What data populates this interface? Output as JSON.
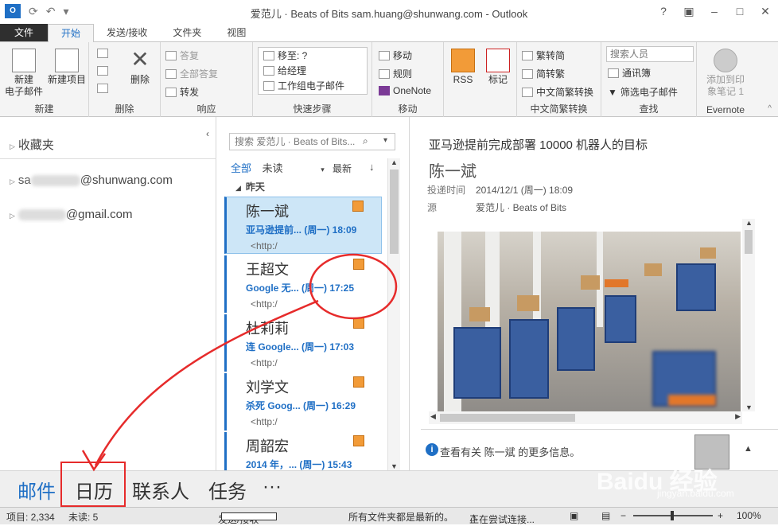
{
  "window": {
    "title": "爱范儿 · Beats of Bits   sam.huang@shunwang.com - Outlook",
    "app_icon": "O"
  },
  "tabs": [
    "文件",
    "开始",
    "发送/接收",
    "文件夹",
    "视图"
  ],
  "ribbon": {
    "new_email": "新建\n电子邮件",
    "new_items": "新建项目",
    "group_new": "新建",
    "delete": "删除",
    "group_delete": "删除",
    "reply": "答复",
    "reply_all": "全部答复",
    "forward": "转发",
    "group_respond": "响应",
    "quick_steps": [
      "移至: ?",
      "给经理",
      "工作组电子邮件"
    ],
    "group_quick": "快速步骤",
    "move": "移动",
    "rules": "规则",
    "onenote": "OneNote",
    "group_move": "移动",
    "rss": "RSS",
    "tag": "标记",
    "trad_to_simp": "繁转简",
    "simp_to_trad": "简转繁",
    "convert": "中文简繁转换",
    "group_cn": "中文简繁转换",
    "search_people": "搜索人员",
    "address_book": "通讯簿",
    "filter_email": "筛选电子邮件",
    "group_find": "查找",
    "evernote_add": "添加到印\n象笔记 1",
    "group_evernote": "Evernote"
  },
  "nav": {
    "favorites": "收藏夹",
    "account1_suffix": "@shunwang.com",
    "account2_suffix": "@gmail.com"
  },
  "list": {
    "search_placeholder": "搜索 爱范儿 · Beats of Bits...",
    "filter_all": "全部",
    "filter_unread": "未读",
    "sort": "最新",
    "group": "昨天",
    "items": [
      {
        "sender": "陈一斌",
        "subject": "亚马逊提前... (周一) 18:09",
        "preview": "<http:/"
      },
      {
        "sender": "王超文",
        "subject": "Google 无... (周一) 17:25",
        "preview": "<http:/"
      },
      {
        "sender": "杜莉莉",
        "subject": "连 Google... (周一) 17:03",
        "preview": "<http:/"
      },
      {
        "sender": "刘学文",
        "subject": "杀死 Goog... (周一) 16:29",
        "preview": "<http:/"
      },
      {
        "sender": "周韶宏",
        "subject": "2014 年，... (周一) 15:43",
        "preview": ""
      }
    ]
  },
  "reading": {
    "subject": "亚马逊提前完成部署 10000 机器人的目标",
    "sender": "陈一斌",
    "sent_label": "投递时间",
    "sent_value": "2014/12/1 (周一) 18:09",
    "source_label": "源",
    "source_value": "爱范儿 · Beats of Bits",
    "people_info": "查看有关 陈一斌 的更多信息。"
  },
  "bottom_nav": [
    "邮件",
    "日历",
    "联系人",
    "任务",
    "···"
  ],
  "status": {
    "items": "项目: 2,334",
    "unread": "未读: 5",
    "sendrecv": "发送/接收",
    "uptodate": "所有文件夹都是最新的。",
    "connecting": "正在尝试连接...",
    "zoom": "100%"
  },
  "watermark": {
    "main": "Baidu 经验",
    "sub": "jingyan.baidu.com"
  },
  "colors": {
    "accent": "#1f6fc5",
    "annotation": "#e62b2b"
  }
}
